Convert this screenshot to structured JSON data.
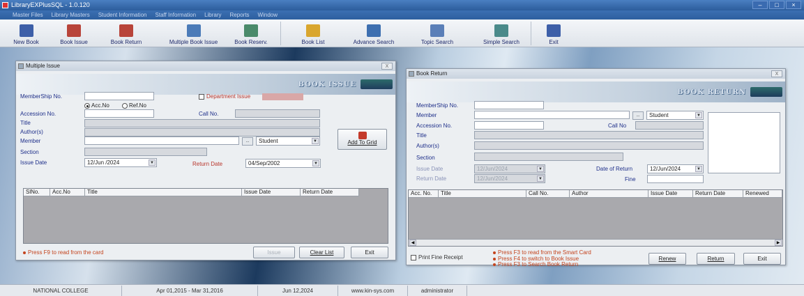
{
  "app": {
    "title": "LibraryEXPlusSQL - 1.0.120",
    "win_min": "–",
    "win_max": "□",
    "win_close": "×"
  },
  "menu": [
    "Master Files",
    "Library Masters",
    "Student Information",
    "Staff Information",
    "Library",
    "Reports",
    "Window"
  ],
  "toolbar": [
    {
      "label": "New Book",
      "icon": "new-book-icon",
      "color": "#3d5fa8"
    },
    {
      "label": "Book Issue",
      "icon": "book-issue-icon",
      "color": "#b8443a"
    },
    {
      "label": "Book Return",
      "icon": "book-return-icon",
      "color": "#b8443a"
    },
    {
      "label": "Multiple Book Issue",
      "icon": "multiple-book-issue-icon",
      "color": "#4b7bb8"
    },
    {
      "label": "Book Reserv.",
      "icon": "book-reserve-icon",
      "color": "#4a8a6a"
    },
    {
      "label": "Book List",
      "icon": "book-list-icon",
      "color": "#d9a62e"
    },
    {
      "label": "Advance Search",
      "icon": "advance-search-icon",
      "color": "#3d6fb0"
    },
    {
      "label": "Topic Search",
      "icon": "topic-search-icon",
      "color": "#5a7fb8"
    },
    {
      "label": "Simple Search",
      "icon": "simple-search-icon",
      "color": "#4a8a8a"
    },
    {
      "label": "Exit",
      "icon": "exit-icon",
      "color": "#3d5fa8"
    }
  ],
  "issue": {
    "title": "Multiple Issue",
    "close": "X",
    "banner": "BOOK ISSUE",
    "membership_label": "MemberShip No.",
    "membership_value": "",
    "dept_issue_label": "Department Issue",
    "radio_accno": "Acc.No",
    "radio_refno": "Ref.No",
    "accession_label": "Accession No.",
    "accession_value": "",
    "callno_label": "Call No.",
    "callno_value": "",
    "title_label": "Title",
    "title_value": "",
    "authors_label": "Author(s)",
    "authors_value": "",
    "member_label": "Member",
    "member_value": "",
    "member_btn": "..",
    "member_type": "Student",
    "section_label": "Section",
    "section_value": "",
    "issue_date_label": "Issue Date",
    "issue_date_value": "12/Jun /2024",
    "return_date_label": "Return Date",
    "return_date_value": "04/Sep/2002",
    "add_to_grid": "Add To Grid",
    "grid_headers": [
      "SlNo.",
      "Acc.No",
      "Title",
      "Issue Date",
      "Return Date"
    ],
    "hint": "Press F9 to read from the card",
    "btn_issue": "Issue",
    "btn_clear": "Clear List",
    "btn_exit": "Exit"
  },
  "return": {
    "title": "Book Return",
    "close": "X",
    "banner": "BOOK RETURN",
    "membership_label": "MemberShip No.",
    "membership_value": "",
    "member_label": "Member",
    "member_value": "",
    "member_btn": "..",
    "member_type": "Student",
    "accession_label": "Accession No.",
    "accession_value": "",
    "callno_label": "Call No",
    "callno_value": "",
    "title_label": "Title",
    "title_value": "",
    "authors_label": "Author(s)",
    "authors_value": "",
    "section_label": "Section",
    "section_value": "",
    "issue_date_label": "Issue Date",
    "issue_date_value": "12/Jun/2024",
    "return_date_label": "Return Date",
    "return_date_value": "12/Jun/2024",
    "date_of_return_label": "Date of Return",
    "date_of_return_value": "12/Jun/2024",
    "fine_label": "Fine",
    "fine_value": "",
    "grid_headers": [
      "Acc. No.",
      "Title",
      "Call No.",
      "Author",
      "Issue Date",
      "Return Date",
      "Renewed"
    ],
    "print_fine_label": "Print Fine Receipt",
    "hints": [
      "Press F3 to read from the Smart Card",
      "Press F4 to switch to Book Issue",
      "Press F3 to Search Book Return"
    ],
    "btn_renew": "Renew",
    "btn_return": "Return",
    "btn_exit": "Exit"
  },
  "status": [
    "NATIONAL COLLEGE",
    "Apr 01,2015 - Mar 31,2016",
    "Jun 12,2024",
    "www.kin-sys.com",
    "administrator"
  ]
}
